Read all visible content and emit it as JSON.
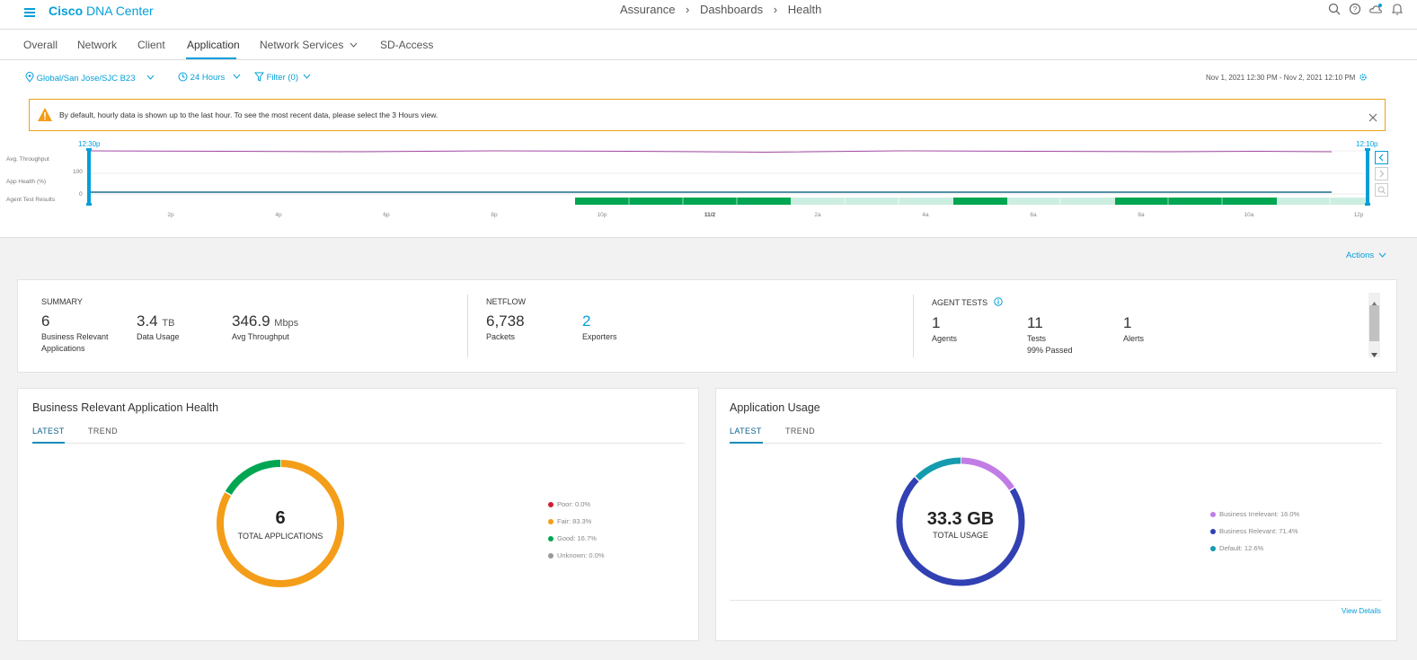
{
  "header": {
    "menu_icon": "hamburger-menu-icon",
    "brand_cisco": "Cisco",
    "brand_product": "DNA Center",
    "breadcrumb": [
      "Assurance",
      "Dashboards",
      "Health"
    ],
    "icons": [
      "search-icon",
      "help-icon",
      "cloud-notification-icon",
      "bell-icon"
    ]
  },
  "tabs": [
    {
      "label": "Overall",
      "active": false
    },
    {
      "label": "Network",
      "active": false
    },
    {
      "label": "Client",
      "active": false
    },
    {
      "label": "Application",
      "active": true
    },
    {
      "label": "Network Services",
      "active": false,
      "dropdown": true
    },
    {
      "label": "SD-Access",
      "active": false
    }
  ],
  "filters": {
    "location": "Global/San Jose/SJC B23",
    "time_range": "24 Hours",
    "filter": "Filter (0)",
    "date_range": "Nov 1, 2021 12:30 PM - Nov 2, 2021 12:10 PM"
  },
  "banner": {
    "message": "By default, hourly data is shown up to the last hour. To see the most recent data, please select the 3 Hours view."
  },
  "timeline": {
    "start_label": "12:30p",
    "end_label": "12:10p",
    "row_labels": [
      "Avg. Throughput",
      "App Health (%)",
      "Agent Test Results"
    ],
    "y_ticks": [
      "100",
      "0"
    ],
    "x_ticks": [
      "2p",
      "4p",
      "6p",
      "8p",
      "10p",
      "11/2",
      "2a",
      "4a",
      "6a",
      "8a",
      "10a",
      "12p"
    ],
    "colors": {
      "throughput": "#a64ca6",
      "health": "#1d6f8c",
      "agent_pass": "#00a651",
      "agent_light": "#cceee0",
      "handle": "#049fd9"
    }
  },
  "actions_label": "Actions",
  "summary": {
    "title": "SUMMARY",
    "metrics": [
      {
        "value": "6",
        "unit": "",
        "label": "Business Relevant Applications"
      },
      {
        "value": "3.4",
        "unit": "TB",
        "label": "Data Usage"
      },
      {
        "value": "346.9",
        "unit": "Mbps",
        "label": "Avg Throughput"
      }
    ]
  },
  "netflow": {
    "title": "NETFLOW",
    "metrics": [
      {
        "value": "6,738",
        "label": "Packets"
      },
      {
        "value": "2",
        "label": "Exporters"
      }
    ]
  },
  "agent_tests": {
    "title": "AGENT TESTS",
    "metrics": [
      {
        "value": "1",
        "label": "Agents"
      },
      {
        "value": "11",
        "label": "Tests",
        "sub": "99% Passed"
      },
      {
        "value": "1",
        "label": "Alerts"
      }
    ]
  },
  "health_panel": {
    "title": "Business Relevant Application Health",
    "tabs": [
      "LATEST",
      "TREND"
    ],
    "center_value": "6",
    "center_label": "TOTAL APPLICATIONS",
    "legend": [
      {
        "label": "Poor: 0.0%",
        "color": "#cf2030"
      },
      {
        "label": "Fair: 83.3%",
        "color": "#f49d19"
      },
      {
        "label": "Good: 16.7%",
        "color": "#00a651"
      },
      {
        "label": "Unknown: 0.0%",
        "color": "#999999"
      }
    ]
  },
  "usage_panel": {
    "title": "Application Usage",
    "tabs": [
      "LATEST",
      "TREND"
    ],
    "center_value": "33.3 GB",
    "center_label": "TOTAL USAGE",
    "legend": [
      {
        "label": "Business Irrelevant: 16.0%",
        "color": "#c17ce6"
      },
      {
        "label": "Business Relevant: 71.4%",
        "color": "#3140b2"
      },
      {
        "label": "Default: 12.6%",
        "color": "#149cae"
      }
    ],
    "view_details": "View Details"
  },
  "chart_data": [
    {
      "type": "pie",
      "title": "Business Relevant Application Health",
      "categories": [
        "Poor",
        "Fair",
        "Good",
        "Unknown"
      ],
      "values": [
        0.0,
        83.3,
        16.7,
        0.0
      ],
      "colors": [
        "#cf2030",
        "#f49d19",
        "#00a651",
        "#999999"
      ],
      "total": "6"
    },
    {
      "type": "pie",
      "title": "Application Usage",
      "categories": [
        "Business Irrelevant",
        "Business Relevant",
        "Default"
      ],
      "values": [
        16.0,
        71.4,
        12.6
      ],
      "colors": [
        "#c17ce6",
        "#3140b2",
        "#149cae"
      ],
      "total": "33.3 GB"
    }
  ]
}
